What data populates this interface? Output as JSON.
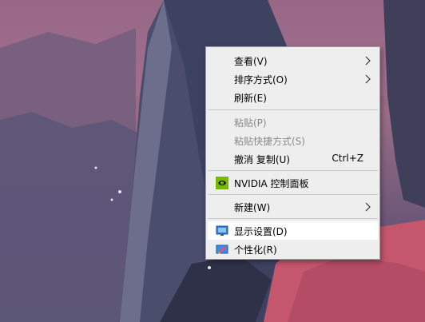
{
  "colors": {
    "menu_bg": "#eeeeee",
    "menu_border": "#a0a0a0",
    "disabled_text": "#8a8a8a",
    "hover_bg": "#ffffff",
    "nvidia_green": "#76b900"
  },
  "context_menu": {
    "items": [
      {
        "label": "查看(V)",
        "submenu": true,
        "enabled": true
      },
      {
        "label": "排序方式(O)",
        "submenu": true,
        "enabled": true
      },
      {
        "label": "刷新(E)",
        "enabled": true
      },
      {
        "label": "粘贴(P)",
        "enabled": false
      },
      {
        "label": "粘贴快捷方式(S)",
        "enabled": false
      },
      {
        "label": "撤消 复制(U)",
        "shortcut": "Ctrl+Z",
        "enabled": true
      },
      {
        "label": "NVIDIA 控制面板",
        "icon": "nvidia-icon",
        "enabled": true
      },
      {
        "label": "新建(W)",
        "submenu": true,
        "enabled": true
      },
      {
        "label": "显示设置(D)",
        "icon": "display-icon",
        "enabled": true,
        "highlighted": true
      },
      {
        "label": "个性化(R)",
        "icon": "personalize-icon",
        "enabled": true
      }
    ]
  }
}
